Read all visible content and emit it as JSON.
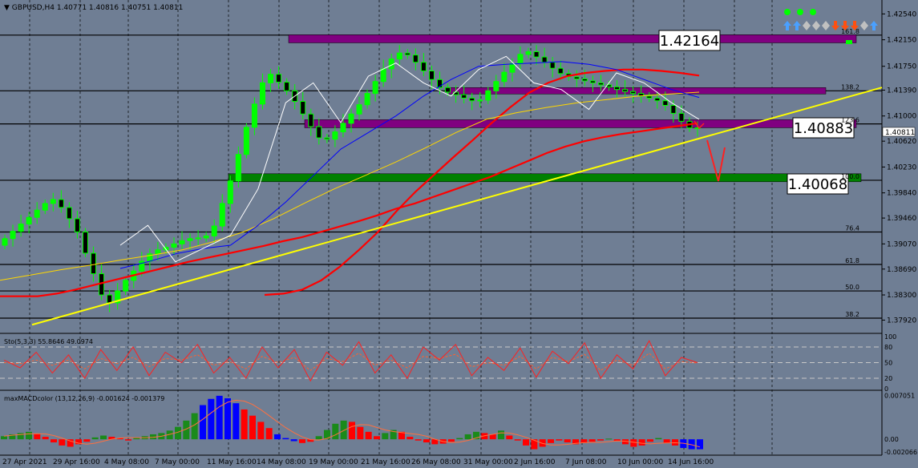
{
  "header": {
    "symbol": "GBPUSD,H4",
    "ohlc": "1.40771 1.40816 1.40751 1.40811"
  },
  "colors": {
    "background": "#6f7e94",
    "bull_candle": "#00ff00",
    "bear_candle": "#00ff00",
    "ma_red": "#ff0000",
    "ma_blue": "#0000ff",
    "ma_white": "#ffffff",
    "ma_yellow": "#ffd700",
    "trendline": "#ffff00",
    "resistance_zone": "#800080",
    "support_zone": "#008000",
    "hist_green": "#1a8a1a",
    "hist_red": "#ff0000",
    "hist_blue": "#0000ff"
  },
  "chart_data": {
    "type": "candlestick",
    "price_axis": {
      "ylim": [
        1.3772,
        1.4275
      ],
      "ticks": [
        "1.42540",
        "1.42150",
        "1.41750",
        "1.41390",
        "1.41000",
        "1.40620",
        "1.40230",
        "1.39840",
        "1.39460",
        "1.39070",
        "1.38690",
        "1.38300",
        "1.37920"
      ],
      "current_price": "1.40811"
    },
    "time_axis": [
      "27 Apr 2021",
      "29 Apr 16:00",
      "4 May 08:00",
      "7 May 00:00",
      "11 May 16:00",
      "14 May 08:00",
      "19 May 00:00",
      "21 May 16:00",
      "26 May 08:00",
      "31 May 00:00",
      "2 Jun 16:00",
      "7 Jun 08:00",
      "10 Jun 00:00",
      "14 Jun 16:00"
    ],
    "zones": [
      {
        "kind": "resistance",
        "label": "1.42164",
        "value": 1.42164
      },
      {
        "kind": "resistance",
        "label": "",
        "value": 1.4138
      },
      {
        "kind": "resistance",
        "label": "1.40883",
        "value": 1.40883
      },
      {
        "kind": "support",
        "label": "1.40068",
        "value": 1.40068
      }
    ],
    "fibo_levels": [
      {
        "label": "161.8",
        "value": 1.4222
      },
      {
        "label": "138.2",
        "value": 1.4138
      },
      {
        "label": "123.6",
        "value": 1.4088
      },
      {
        "label": "100.0",
        "value": 1.4003
      },
      {
        "label": "76.4",
        "value": 1.3925
      },
      {
        "label": "61.8",
        "value": 1.3876
      },
      {
        "label": "50.0",
        "value": 1.3836
      },
      {
        "label": "38.2",
        "value": 1.3795
      }
    ],
    "candles": {
      "open": [
        1.3905,
        1.3915,
        1.3926,
        1.3937,
        1.3947,
        1.3958,
        1.3968,
        1.3974,
        1.3962,
        1.3945,
        1.3925,
        1.3893,
        1.3862,
        1.383,
        1.3818,
        1.3836,
        1.3852,
        1.3866,
        1.3881,
        1.3892,
        1.3898,
        1.3902,
        1.3907,
        1.3912,
        1.3915,
        1.3916,
        1.3919,
        1.3934,
        1.3968,
        1.4002,
        1.4042,
        1.4083,
        1.4118,
        1.415,
        1.4163,
        1.4151,
        1.4138,
        1.4122,
        1.4103,
        1.4084,
        1.4067,
        1.4065,
        1.4076,
        1.4089,
        1.4103,
        1.4117,
        1.4134,
        1.4152,
        1.4171,
        1.4186,
        1.4195,
        1.4192,
        1.4181,
        1.4168,
        1.4155,
        1.4143,
        1.4136,
        1.4132,
        1.4127,
        1.4123,
        1.4124,
        1.4138,
        1.4152,
        1.4166,
        1.4179,
        1.4193,
        1.4197,
        1.4189,
        1.4181,
        1.4172,
        1.4164,
        1.4159,
        1.4156,
        1.4153,
        1.415,
        1.4147,
        1.4144,
        1.414,
        1.4137,
        1.4134,
        1.413,
        1.4127,
        1.4123,
        1.4116,
        1.4104,
        1.4092,
        1.4082
      ],
      "close": [
        1.3915,
        1.3926,
        1.3937,
        1.3947,
        1.3958,
        1.3968,
        1.3974,
        1.3962,
        1.3945,
        1.3925,
        1.3893,
        1.3862,
        1.383,
        1.3818,
        1.3836,
        1.3852,
        1.3866,
        1.3881,
        1.3892,
        1.3898,
        1.3902,
        1.3907,
        1.3912,
        1.3915,
        1.3916,
        1.3919,
        1.3934,
        1.3968,
        1.4002,
        1.4042,
        1.4083,
        1.4118,
        1.415,
        1.4163,
        1.4151,
        1.4138,
        1.4122,
        1.4103,
        1.4084,
        1.4067,
        1.4065,
        1.4076,
        1.4089,
        1.4103,
        1.4117,
        1.4134,
        1.4152,
        1.4171,
        1.4186,
        1.4195,
        1.4192,
        1.4181,
        1.4168,
        1.4155,
        1.4143,
        1.4136,
        1.4132,
        1.4127,
        1.4123,
        1.4124,
        1.4138,
        1.4152,
        1.4166,
        1.4179,
        1.4193,
        1.4197,
        1.4189,
        1.4181,
        1.4172,
        1.4164,
        1.4159,
        1.4156,
        1.4153,
        1.415,
        1.4147,
        1.4144,
        1.414,
        1.4137,
        1.4134,
        1.413,
        1.4127,
        1.4123,
        1.4116,
        1.4104,
        1.4092,
        1.4082,
        1.4081
      ]
    },
    "series": [
      {
        "name": "",
        "color": "#ff0000",
        "values": [
          1.3828,
          1.3828,
          1.3828,
          1.3832,
          1.3838,
          1.3845,
          1.3852,
          1.3859,
          1.3866,
          1.3873,
          1.388,
          1.3886,
          1.3892,
          1.3898,
          1.3904,
          1.3911,
          1.3917,
          1.3925,
          1.3933,
          1.3941,
          1.395,
          1.396,
          1.3968,
          1.3978,
          1.3988,
          1.3998,
          1.4008,
          1.402,
          1.4032,
          1.4044,
          1.4054,
          1.4062,
          1.4068,
          1.4073,
          1.4077,
          1.4081,
          1.4085,
          1.4089
        ]
      },
      {
        "name": "",
        "color": "#ff0000",
        "values": [
          1.383,
          1.3832,
          1.3838,
          1.3852,
          1.3873,
          1.3898,
          1.3925,
          1.3957,
          1.3986,
          1.4012,
          1.4038,
          1.4063,
          1.4089,
          1.4113,
          1.4135,
          1.415,
          1.416,
          1.4165,
          1.4168,
          1.417,
          1.417,
          1.4168,
          1.4165,
          1.4161
        ]
      },
      {
        "name": "",
        "color": "#ffd700",
        "values": [
          1.3852,
          1.386,
          1.3868,
          1.3875,
          1.3883,
          1.389,
          1.3898,
          1.391,
          1.3925,
          1.3945,
          1.3968,
          1.399,
          1.401,
          1.403,
          1.4052,
          1.4075,
          1.4095,
          1.4105,
          1.4113,
          1.412,
          1.4125,
          1.413,
          1.4133,
          1.4136
        ]
      },
      {
        "name": "",
        "color": "#0000ff",
        "values": [
          1.387,
          1.388,
          1.3892,
          1.39,
          1.3905,
          1.3935,
          1.397,
          1.401,
          1.405,
          1.4075,
          1.41,
          1.413,
          1.4155,
          1.4175,
          1.4178,
          1.418,
          1.4182,
          1.4178,
          1.417,
          1.4155,
          1.414,
          1.4128
        ]
      },
      {
        "name": "",
        "color": "#ffffff",
        "values": [
          1.3905,
          1.3935,
          1.388,
          1.39,
          1.392,
          1.399,
          1.412,
          1.415,
          1.409,
          1.416,
          1.418,
          1.415,
          1.413,
          1.417,
          1.419,
          1.415,
          1.414,
          1.411,
          1.4165,
          1.415,
          1.412,
          1.4095
        ]
      }
    ],
    "stochastic": {
      "label": "Sto(5,3,3) 55.8646 49.0974",
      "levels": [
        "100",
        "80",
        "50",
        "20",
        "0"
      ],
      "k": [
        55,
        40,
        70,
        30,
        65,
        20,
        75,
        35,
        80,
        25,
        70,
        50,
        85,
        30,
        60,
        20,
        80,
        40,
        75,
        15,
        70,
        45,
        90,
        30,
        65,
        20,
        80,
        55,
        85,
        25,
        60,
        35,
        78,
        22,
        72,
        48,
        88,
        20,
        65,
        38,
        92,
        25,
        60,
        50
      ],
      "d": [
        50,
        48,
        55,
        45,
        55,
        38,
        58,
        48,
        60,
        42,
        58,
        55,
        65,
        45,
        52,
        38,
        62,
        50,
        60,
        35,
        58,
        52,
        68,
        45,
        55,
        40,
        62,
        58,
        66,
        42,
        50,
        45,
        62,
        38,
        60,
        52,
        66,
        35,
        55,
        45,
        68,
        38,
        52,
        49
      ]
    },
    "macd": {
      "label": "maxMACDcolor (13,12,26,9) -0.001624 -0.001379",
      "ticks": [
        "0.007051",
        "0.00",
        "-0.002066"
      ],
      "hist": [
        0.0005,
        0.0008,
        0.001,
        0.0012,
        0.0009,
        0.0004,
        -0.0005,
        -0.001,
        -0.0012,
        -0.0008,
        -0.0004,
        0.0003,
        0.0006,
        0.0004,
        0.0002,
        -0.0002,
        0.0003,
        0.0005,
        0.0008,
        0.001,
        0.0014,
        0.002,
        0.003,
        0.0042,
        0.0055,
        0.0065,
        0.007,
        0.0066,
        0.0058,
        0.0048,
        0.0038,
        0.0028,
        0.0018,
        0.0008,
        0.0002,
        -0.0003,
        -0.0006,
        -0.0004,
        0.0005,
        0.0015,
        0.0025,
        0.003,
        0.0028,
        0.002,
        0.0012,
        0.0005,
        0.001,
        0.0015,
        0.0012,
        0.0004,
        -0.0002,
        -0.0005,
        -0.0008,
        -0.0007,
        -0.0004,
        0.0002,
        0.0008,
        0.0012,
        0.001,
        0.0008,
        0.0014,
        0.0006,
        -0.0002,
        -0.001,
        -0.0016,
        -0.0012,
        -0.0006,
        -0.0002,
        -0.0005,
        -0.0008,
        -0.0006,
        -0.0004,
        -0.0002,
        0.0001,
        -0.0003,
        -0.0008,
        -0.0012,
        -0.001,
        -0.0004,
        0.0002,
        -0.0006,
        -0.001,
        -0.0014,
        -0.0016,
        -0.0016
      ]
    },
    "trendline": {
      "from": 1.3785,
      "to": 1.4143
    },
    "icons": [
      "green-dot",
      "green-dot",
      "green-dot",
      "blue-up-arrow",
      "blue-up-arrow",
      "gray-diamond",
      "gray-diamond",
      "gray-diamond",
      "orange-down-arrow",
      "orange-down-arrow",
      "orange-down-arrow",
      "gray-diamond",
      "blue-up-arrow"
    ]
  }
}
